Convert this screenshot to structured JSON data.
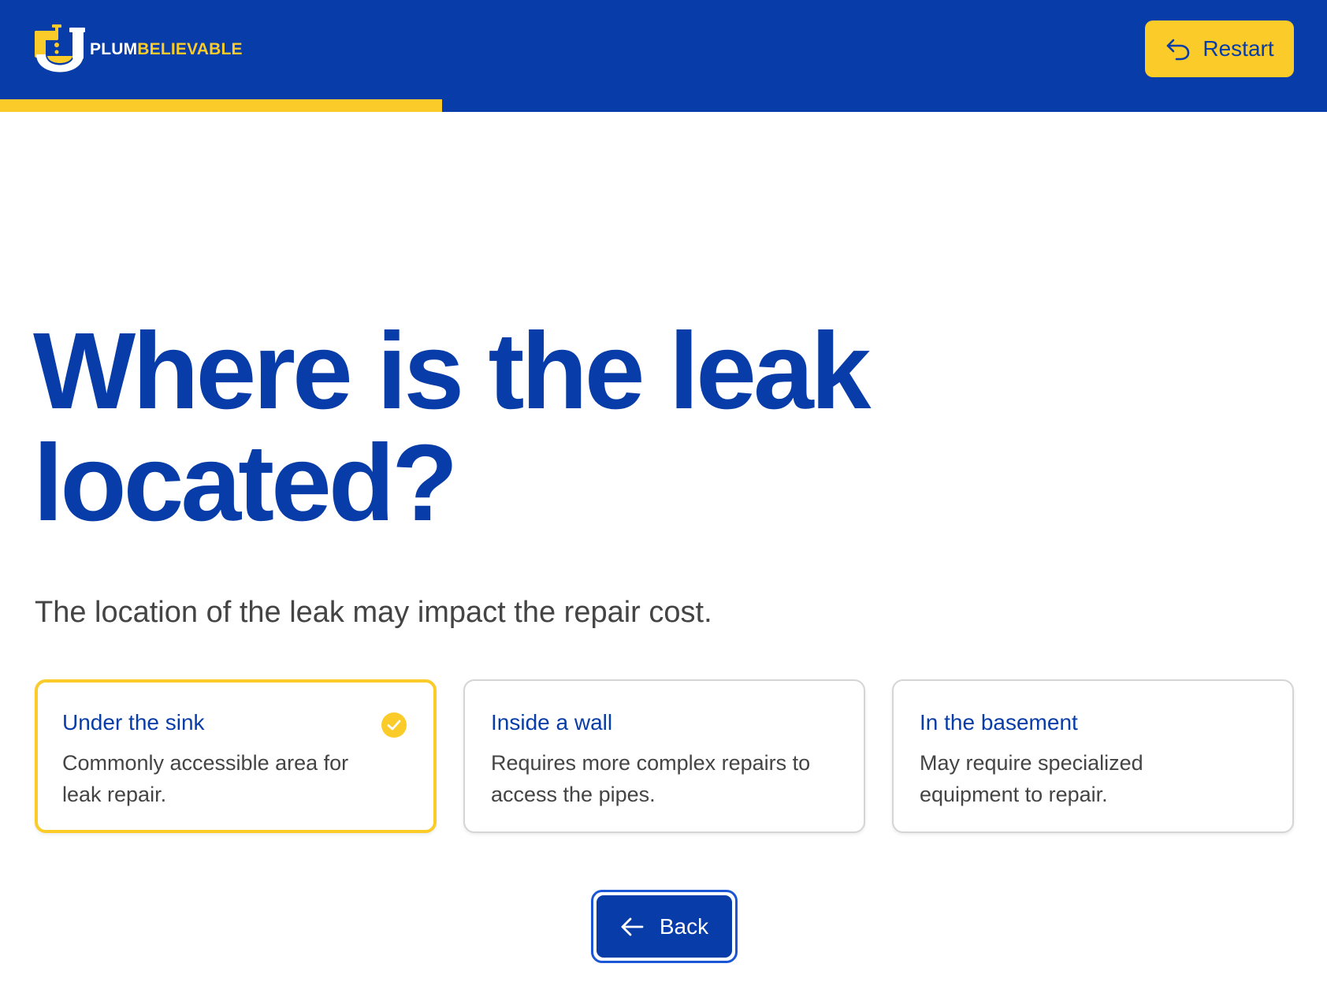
{
  "brand": {
    "name_part1": "PLUM",
    "name_part2": "BELIEVABLE",
    "colors": {
      "primary": "#083ca8",
      "accent": "#fbcb2a",
      "text": "#444444"
    }
  },
  "header": {
    "restart_label": "Restart",
    "restart_icon": "undo-arrow-icon",
    "progress_fraction": 0.333
  },
  "question": {
    "title": "Where is the leak located?",
    "subtitle": "The location of the leak may impact the repair cost."
  },
  "options": [
    {
      "title": "Under the sink",
      "description": "Commonly accessible area for leak repair.",
      "selected": true
    },
    {
      "title": "Inside a wall",
      "description": "Requires more complex repairs to access the pipes.",
      "selected": false
    },
    {
      "title": "In the basement",
      "description": "May require specialized equipment to repair.",
      "selected": false
    }
  ],
  "navigation": {
    "back_label": "Back",
    "back_icon": "arrow-left-icon"
  }
}
